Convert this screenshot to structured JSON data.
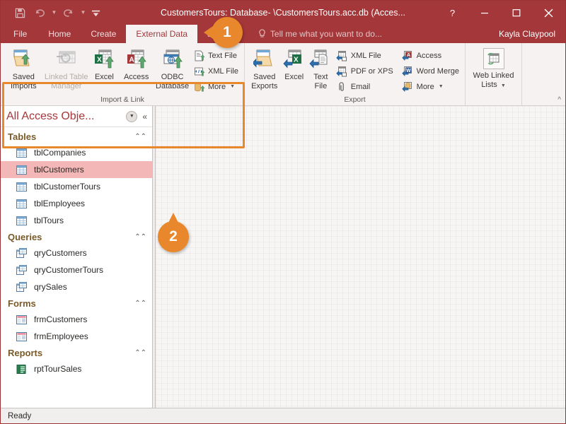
{
  "window": {
    "title": "CustomersTours: Database- \\CustomersTours.acc.db (Acces...",
    "quick_access": [
      {
        "name": "save-icon",
        "label": "Save"
      },
      {
        "name": "undo-icon",
        "label": "Undo"
      },
      {
        "name": "redo-icon",
        "label": "Redo"
      },
      {
        "name": "customize-quick-access-icon",
        "label": "Customize Quick Access Toolbar"
      }
    ],
    "controls": {
      "help": "?",
      "minimize": "Minimize",
      "maximize": "Maximize",
      "close": "Close"
    }
  },
  "tabs": [
    {
      "label": "File",
      "active": false
    },
    {
      "label": "Home",
      "active": false
    },
    {
      "label": "Create",
      "active": false
    },
    {
      "label": "External Data",
      "active": true
    },
    {
      "label": "se Tools",
      "active": false
    }
  ],
  "tellme": {
    "placeholder": "Tell me what you want to do...",
    "icon": "lightbulb-icon"
  },
  "user": {
    "name": "Kayla Claypool"
  },
  "ribbon": {
    "collapse_label": "^",
    "groups": [
      {
        "title": "Import & Link",
        "highlighted": true,
        "big_buttons": [
          {
            "label": "Saved\nImports",
            "line1": "Saved",
            "line2": "Imports",
            "icon": "saved-imports-icon",
            "disabled": false
          },
          {
            "label": "Linked Table Manager",
            "line1": "Linked Table",
            "line2": "Manager",
            "icon": "linked-table-manager-icon",
            "disabled": true
          },
          {
            "label": "Excel",
            "line1": "Excel",
            "line2": "",
            "icon": "excel-import-icon",
            "disabled": false
          },
          {
            "label": "Access",
            "line1": "Access",
            "line2": "",
            "icon": "access-import-icon",
            "disabled": false
          },
          {
            "label": "ODBC Database",
            "line1": "ODBC",
            "line2": "Database",
            "icon": "odbc-database-icon",
            "disabled": false
          }
        ],
        "small_buttons": [
          {
            "label": "Text File",
            "icon": "text-file-import-icon",
            "dropdown": false
          },
          {
            "label": "XML File",
            "icon": "xml-file-import-icon",
            "dropdown": false
          },
          {
            "label": "More",
            "icon": "more-import-icon",
            "dropdown": true
          }
        ]
      },
      {
        "title": "Export",
        "highlighted": false,
        "big_buttons": [
          {
            "label": "Saved Exports",
            "line1": "Saved",
            "line2": "Exports",
            "icon": "saved-exports-icon",
            "disabled": false
          },
          {
            "label": "Excel",
            "line1": "Excel",
            "line2": "",
            "icon": "excel-export-icon",
            "disabled": false
          },
          {
            "label": "Text File",
            "line1": "Text",
            "line2": "File",
            "icon": "text-file-export-icon",
            "disabled": false
          }
        ],
        "small_buttons_col1": [
          {
            "label": "XML File",
            "icon": "xml-file-export-icon",
            "dropdown": false
          },
          {
            "label": "PDF or XPS",
            "icon": "pdf-or-xps-icon",
            "dropdown": false
          },
          {
            "label": "Email",
            "icon": "email-export-icon",
            "dropdown": false
          }
        ],
        "small_buttons_col2": [
          {
            "label": "Access",
            "icon": "access-export-icon",
            "dropdown": false
          },
          {
            "label": "Word Merge",
            "icon": "word-merge-icon",
            "dropdown": false
          },
          {
            "label": "More",
            "icon": "more-export-icon",
            "dropdown": true
          }
        ]
      },
      {
        "title": "",
        "highlighted": false,
        "big_buttons": [
          {
            "label": "Web Linked Lists",
            "line1": "Web Linked",
            "line2": "Lists",
            "icon": "web-linked-lists-icon",
            "disabled": false,
            "dropdown": true
          }
        ],
        "small_buttons": []
      }
    ]
  },
  "navpane": {
    "title": "All Access Obje...",
    "dropdown_icon": "chevron-down-icon",
    "collapse_icon": "double-chevron-left-icon",
    "groups": [
      {
        "name": "Tables",
        "chevron": "double-chevron-up-icon",
        "items": [
          {
            "label": "tblCompanies",
            "icon": "table-icon",
            "selected": false
          },
          {
            "label": "tblCustomers",
            "icon": "table-icon",
            "selected": true
          },
          {
            "label": "tblCustomerTours",
            "icon": "table-icon",
            "selected": false
          },
          {
            "label": "tblEmployees",
            "icon": "table-icon",
            "selected": false
          },
          {
            "label": "tblTours",
            "icon": "table-icon",
            "selected": false
          }
        ]
      },
      {
        "name": "Queries",
        "chevron": "double-chevron-up-icon",
        "items": [
          {
            "label": "qryCustomers",
            "icon": "query-icon",
            "selected": false
          },
          {
            "label": "qryCustomerTours",
            "icon": "query-icon",
            "selected": false
          },
          {
            "label": "qrySales",
            "icon": "query-icon",
            "selected": false
          }
        ]
      },
      {
        "name": "Forms",
        "chevron": "double-chevron-up-icon",
        "items": [
          {
            "label": "frmCustomers",
            "icon": "form-icon",
            "selected": false
          },
          {
            "label": "frmEmployees",
            "icon": "form-icon",
            "selected": false
          }
        ]
      },
      {
        "name": "Reports",
        "chevron": "double-chevron-up-icon",
        "items": [
          {
            "label": "rptTourSales",
            "icon": "report-icon",
            "selected": false
          }
        ]
      }
    ]
  },
  "statusbar": {
    "text": "Ready"
  },
  "callouts": [
    {
      "number": "1",
      "target": "external-data-tab"
    },
    {
      "number": "2",
      "target": "navigation-pane"
    }
  ],
  "colors": {
    "titlebar": "#A4373A",
    "accent_orange": "#E8872B",
    "ribbon_bg": "#F5F2F1",
    "selection_pink": "#F4B7B7",
    "group_heading": "#7A5A28"
  }
}
